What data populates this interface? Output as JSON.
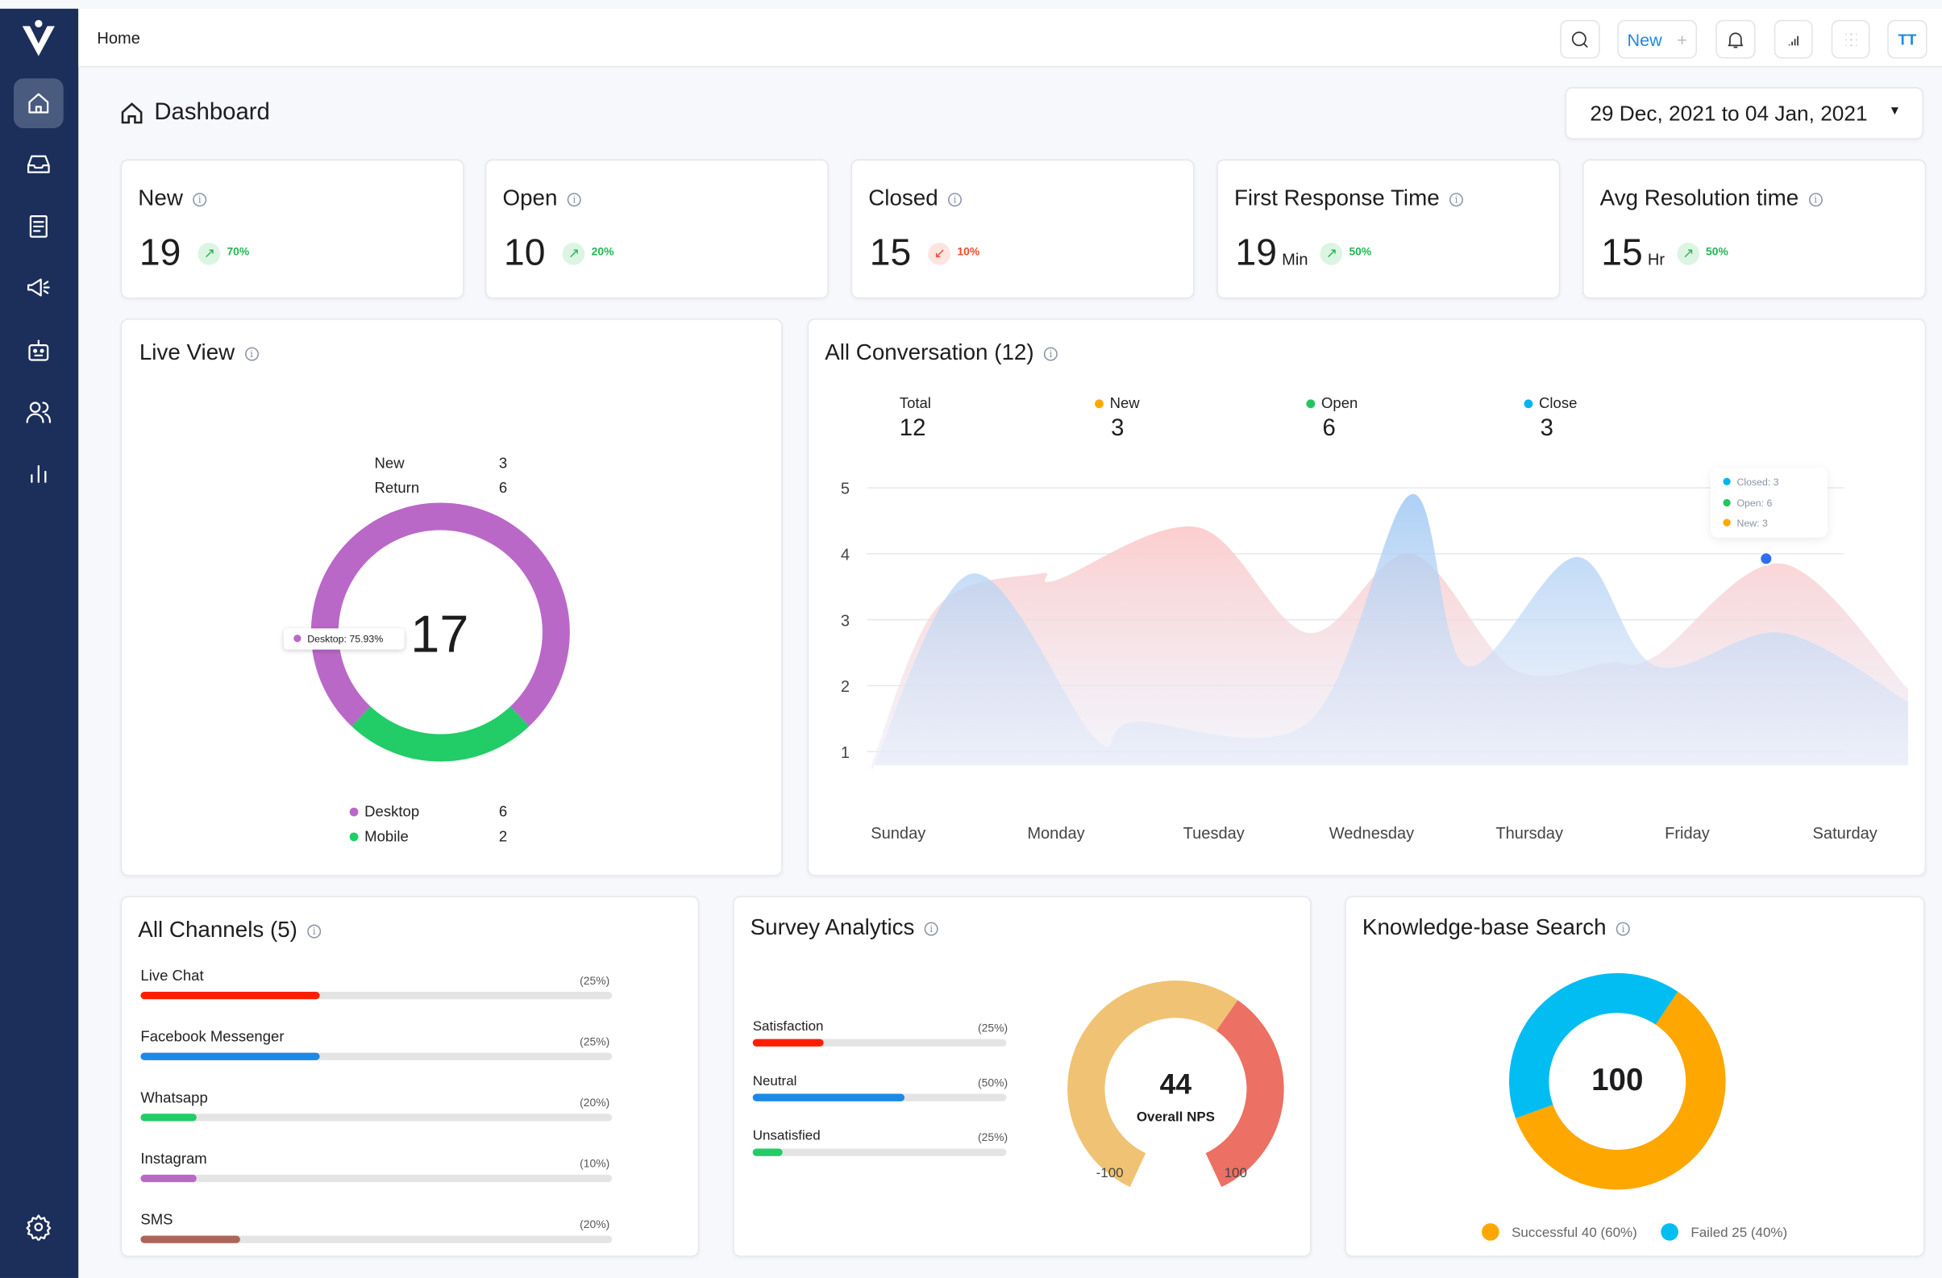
{
  "header": {
    "breadcrumb": "Home",
    "new_label": "New",
    "new_plus": "+",
    "avatar": "TT",
    "icons": [
      "search-icon",
      "bell-icon",
      "signal-icon",
      "grid-icon"
    ]
  },
  "sidebar": {
    "items": [
      {
        "name": "home",
        "active": true
      },
      {
        "name": "inbox"
      },
      {
        "name": "knowledge-base"
      },
      {
        "name": "campaigns"
      },
      {
        "name": "bot"
      },
      {
        "name": "contacts"
      },
      {
        "name": "reports"
      },
      {
        "name": "settings"
      }
    ]
  },
  "page": {
    "title": "Dashboard",
    "date_range": "29 Dec, 2021 to 04 Jan, 2021"
  },
  "kpis": [
    {
      "label": "New",
      "value": "19",
      "unit": "",
      "trend": "up",
      "pct": "70%"
    },
    {
      "label": "Open",
      "value": "10",
      "unit": "",
      "trend": "up",
      "pct": "20%"
    },
    {
      "label": "Closed",
      "value": "15",
      "unit": "",
      "trend": "down",
      "pct": "10%"
    },
    {
      "label": "First Response Time",
      "value": "19",
      "unit": "Min",
      "trend": "up",
      "pct": "50%"
    },
    {
      "label": "Avg Resolution time",
      "value": "15",
      "unit": "Hr",
      "trend": "up",
      "pct": "50%"
    }
  ],
  "live_view": {
    "title": "Live View",
    "top_legend": [
      {
        "label": "New",
        "value": "3"
      },
      {
        "label": "Return",
        "value": "6"
      }
    ],
    "total": "17",
    "tooltip": "Desktop: 75.93%",
    "bottom_legend": [
      {
        "label": "Desktop",
        "value": "6",
        "color": "#ba68c8"
      },
      {
        "label": "Mobile",
        "value": "2",
        "color": "#22cc66"
      }
    ]
  },
  "conversation": {
    "title": "All Conversation (12)",
    "stats": [
      {
        "label": "Total",
        "value": "12",
        "color": ""
      },
      {
        "label": "New",
        "value": "3",
        "color": "#ffa800"
      },
      {
        "label": "Open",
        "value": "6",
        "color": "#22c55e"
      },
      {
        "label": "Close",
        "value": "3",
        "color": "#00b4f0"
      }
    ],
    "tooltip": [
      {
        "label": "Closed: 3",
        "color": "#00b4f0"
      },
      {
        "label": "Open: 6",
        "color": "#22c55e"
      },
      {
        "label": "New: 3",
        "color": "#ffa800"
      }
    ]
  },
  "chart_data": {
    "type": "area",
    "categories": [
      "Sunday",
      "Monday",
      "Tuesday",
      "Wednesday",
      "Thursday",
      "Friday",
      "Saturday"
    ],
    "yticks": [
      "1",
      "2",
      "3",
      "4",
      "5"
    ],
    "ylim": [
      1,
      5
    ],
    "grid": true,
    "series": [
      {
        "color": "#fcc9c9",
        "points": [
          [
            -0.17,
            0.8
          ],
          [
            0.25,
            3.2
          ],
          [
            0.9,
            3.7
          ],
          [
            1.0,
            3.6
          ],
          [
            1.9,
            4.4
          ],
          [
            2.6,
            2.8
          ],
          [
            3.25,
            4.0
          ],
          [
            3.9,
            2.25
          ],
          [
            4.5,
            2.35
          ],
          [
            4.8,
            2.45
          ],
          [
            5.6,
            3.85
          ],
          [
            6.4,
            1.95
          ]
        ]
      },
      {
        "color": "#9fc8f3",
        "points": [
          [
            -0.17,
            0.7
          ],
          [
            0.47,
            3.7
          ],
          [
            1.25,
            1.2
          ],
          [
            1.5,
            1.45
          ],
          [
            2.6,
            1.45
          ],
          [
            3.25,
            4.9
          ],
          [
            3.6,
            2.3
          ],
          [
            4.3,
            3.95
          ],
          [
            4.8,
            2.3
          ],
          [
            5.6,
            2.8
          ],
          [
            6.4,
            1.75
          ]
        ]
      }
    ],
    "highlight": {
      "day": 5.5,
      "value": 3.85
    }
  },
  "channels": {
    "title": "All Channels (5)",
    "items": [
      {
        "label": "Live Chat",
        "pct": "(25%)",
        "fill": 0.38,
        "color": "#ff1f00"
      },
      {
        "label": "Facebook Messenger",
        "pct": "(25%)",
        "fill": 0.38,
        "color": "#1e88e5"
      },
      {
        "label": "Whatsapp",
        "pct": "(20%)",
        "fill": 0.12,
        "color": "#22cc66"
      },
      {
        "label": "Instagram",
        "pct": "(10%)",
        "fill": 0.12,
        "color": "#ba68c8"
      },
      {
        "label": "SMS",
        "pct": "(20%)",
        "fill": 0.21,
        "color": "#ad655a"
      }
    ]
  },
  "survey": {
    "title": "Survey Analytics",
    "items": [
      {
        "label": "Satisfaction",
        "pct": "(25%)",
        "fill": 0.28,
        "color": "#ff1f00"
      },
      {
        "label": "Neutral",
        "pct": "(50%)",
        "fill": 0.6,
        "color": "#1e88e5"
      },
      {
        "label": "Unsatisfied",
        "pct": "(25%)",
        "fill": 0.12,
        "color": "#22cc66"
      }
    ],
    "nps": "44",
    "nps_label": "Overall NPS",
    "min": "-100",
    "max": "100",
    "gauge_colors": [
      "#f0c273",
      "#ec7063"
    ]
  },
  "kb": {
    "title": "Knowledge-base Search",
    "total": "100",
    "legend": [
      {
        "label": "Successful 40 (60%)",
        "color": "#fda700",
        "share": 0.6
      },
      {
        "label": "Failed 25 (40%)",
        "color": "#02bdf2",
        "share": 0.4
      }
    ]
  }
}
